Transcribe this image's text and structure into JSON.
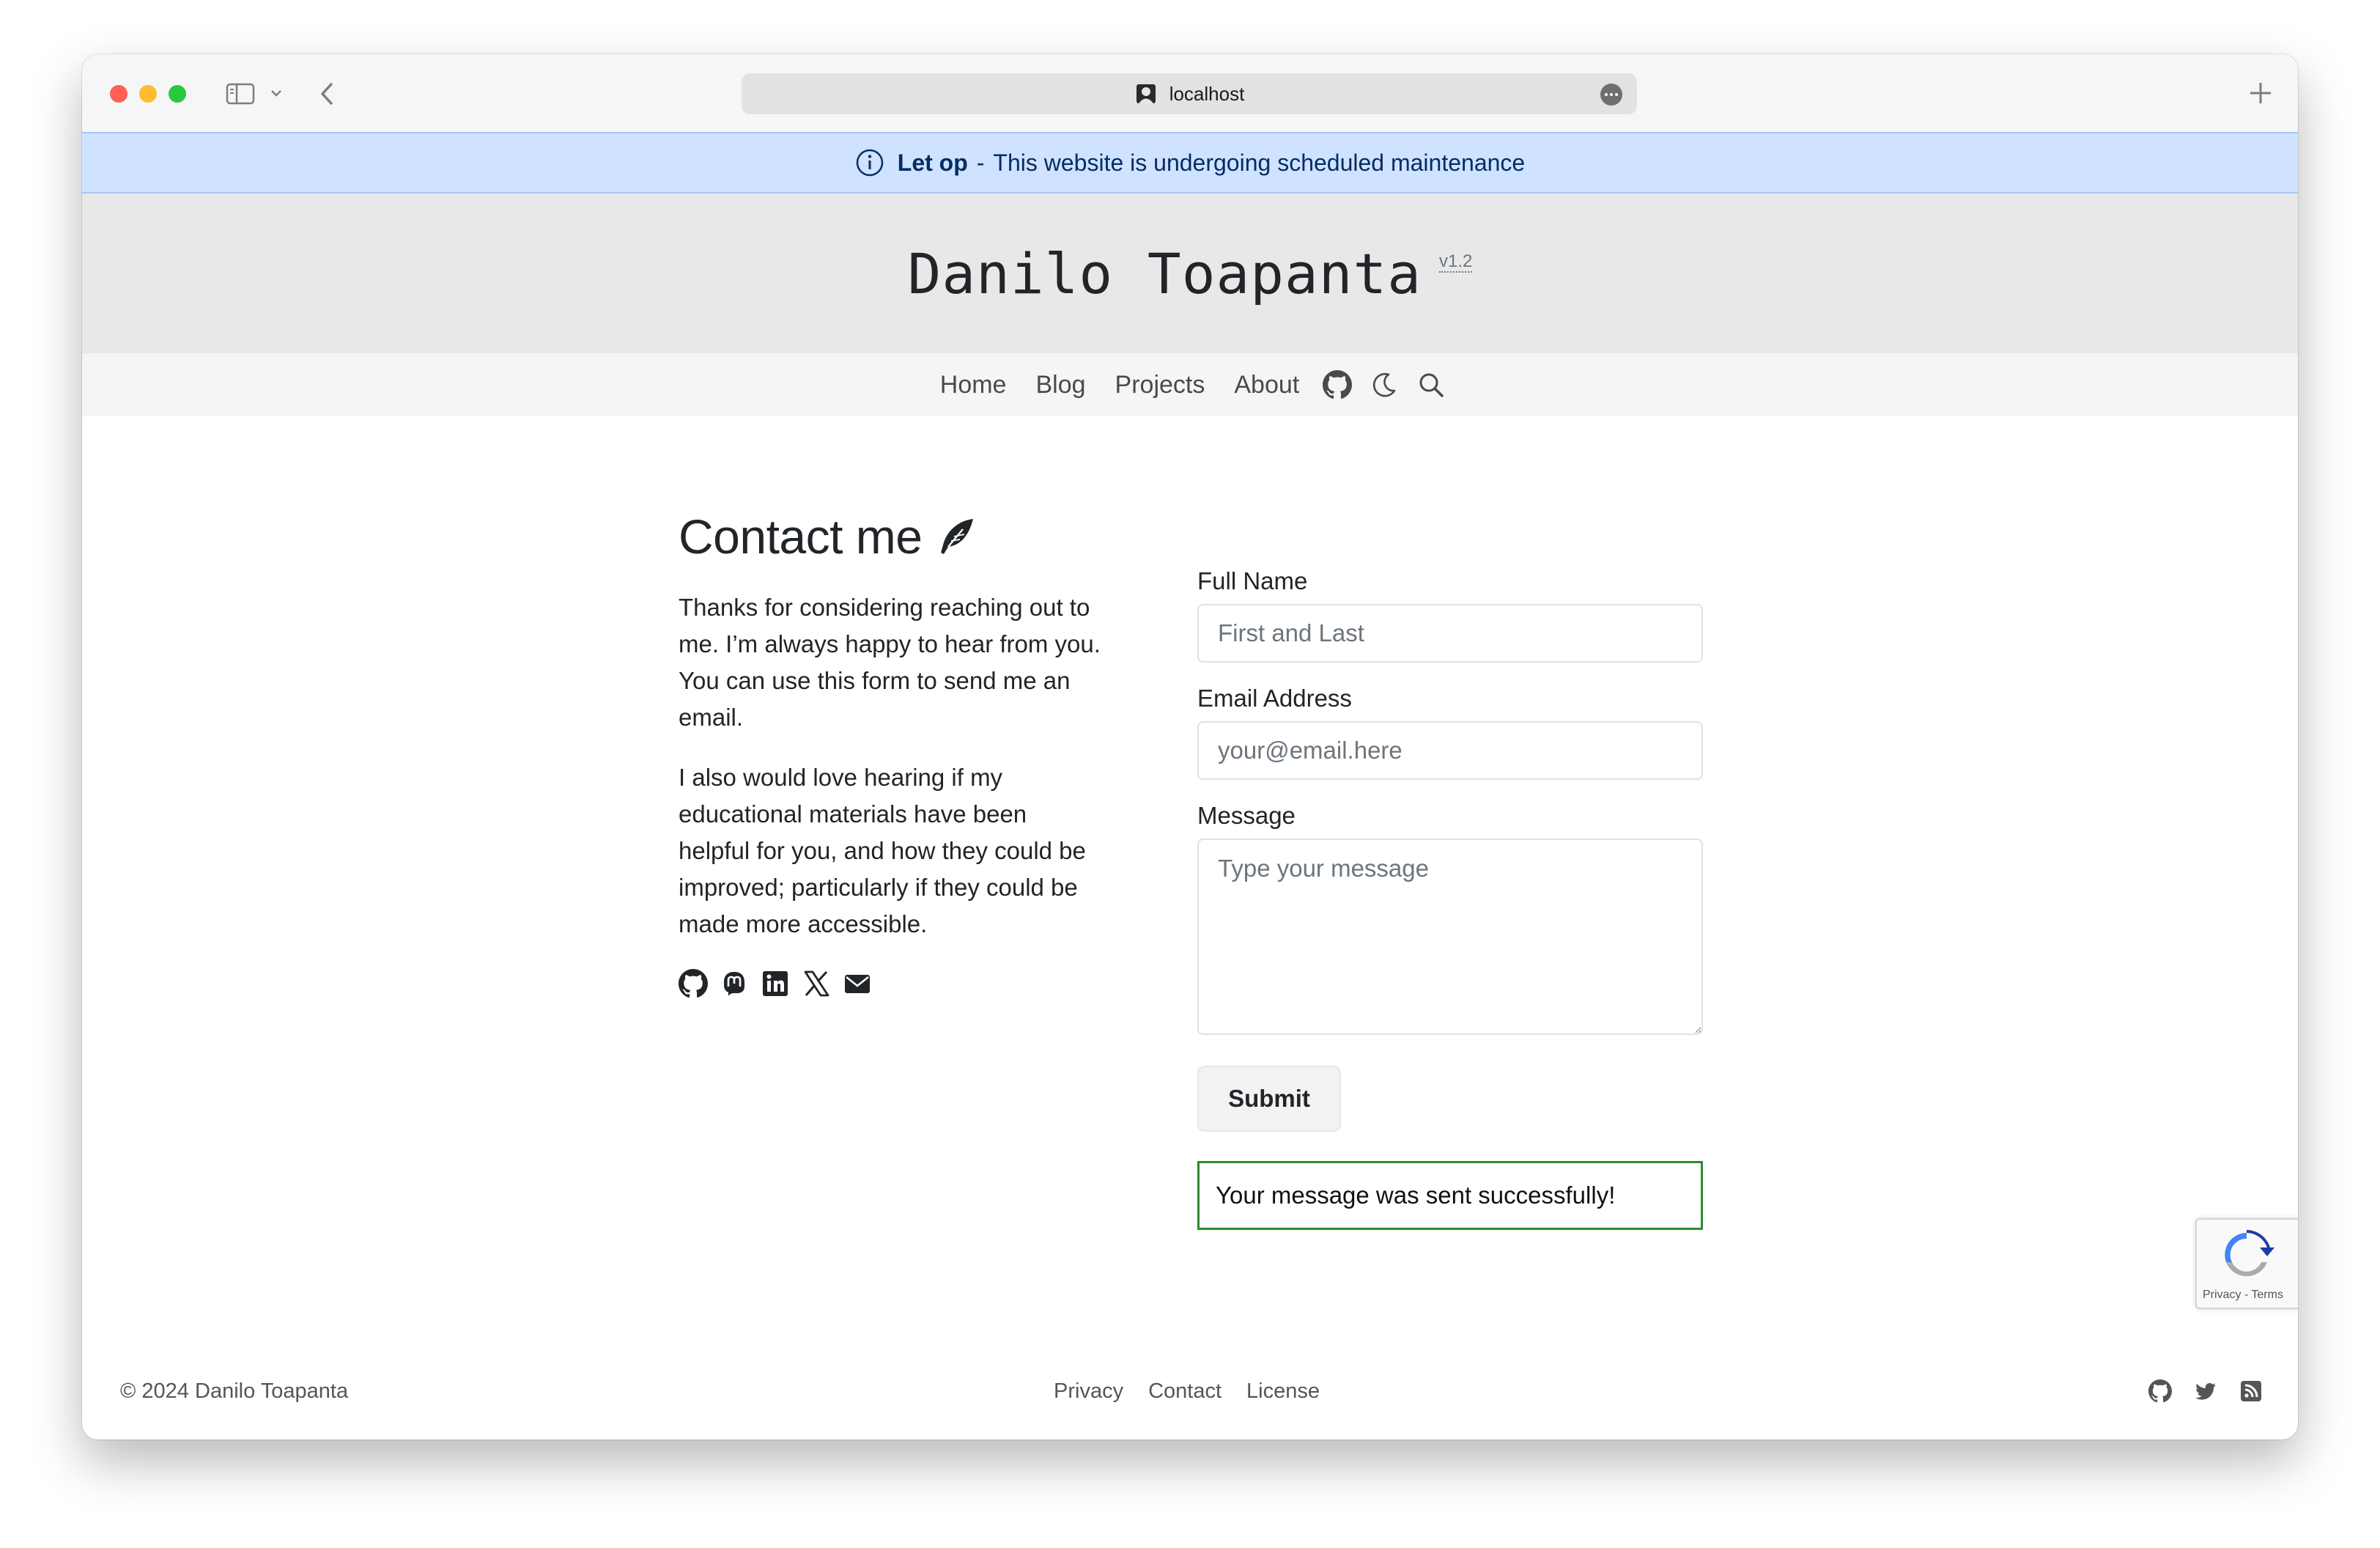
{
  "browser": {
    "url": "localhost",
    "icons": {
      "sidebar": "sidebar-icon",
      "back": "chevron-left-icon",
      "new_tab": "plus-icon",
      "more": "ellipsis-icon"
    }
  },
  "banner": {
    "strong": "Let op",
    "separator": "-",
    "message": "This website is undergoing scheduled maintenance",
    "icon": "info-circle-icon"
  },
  "header": {
    "title": "Danilo Toapanta",
    "version": "v1.2"
  },
  "nav": {
    "links": [
      "Home",
      "Blog",
      "Projects",
      "About"
    ],
    "icons": [
      "github-icon",
      "moon-icon",
      "search-icon"
    ]
  },
  "contact": {
    "heading": "Contact me",
    "heading_icon": "feather-icon",
    "paragraph1": "Thanks for considering reaching out to me. I’m always happy to hear from you. You can use this form to send me an email.",
    "paragraph2": "I also would love hearing if my educational materials have been helpful for you, and how they could be improved; particularly if they could be made more accessible.",
    "social_icons": [
      "github-icon",
      "mastodon-icon",
      "linkedin-icon",
      "x-icon",
      "envelope-icon"
    ]
  },
  "form": {
    "name_label": "Full Name",
    "name_placeholder": "First and Last",
    "email_label": "Email Address",
    "email_placeholder": "your@email.here",
    "message_label": "Message",
    "message_placeholder": "Type your message",
    "submit_label": "Submit",
    "success_message": "Your message was sent successfully!"
  },
  "recaptcha": {
    "links": "Privacy - Terms"
  },
  "footer": {
    "copyright": "© 2024 Danilo Toapanta",
    "links": [
      "Privacy",
      "Contact",
      "License"
    ],
    "icons": [
      "github-icon",
      "twitter-icon",
      "rss-icon"
    ]
  },
  "colors": {
    "banner_bg": "#cfe2ff",
    "banner_text": "#052c65",
    "header_bg": "#e8e8e8",
    "nav_bg": "#f5f5f5",
    "success_border": "#2e8b2e"
  }
}
